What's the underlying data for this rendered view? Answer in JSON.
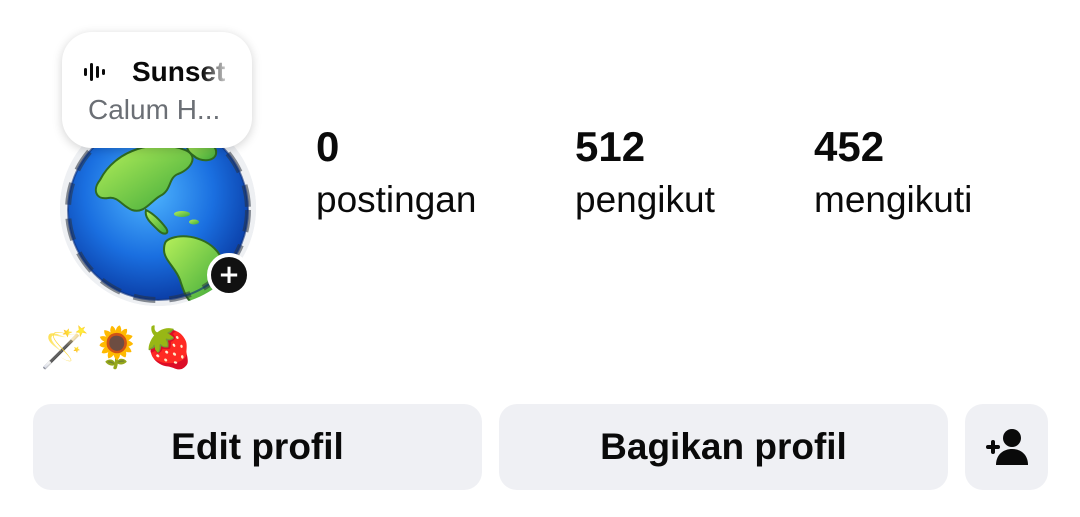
{
  "note": {
    "song_title": "Sunset",
    "artist": "Calum H...",
    "icon": "equalizer-icon"
  },
  "avatar": {
    "description_icon": "globe-avatar",
    "add_icon": "plus-icon"
  },
  "stats": [
    {
      "value": "0",
      "label": "postingan"
    },
    {
      "value": "512",
      "label": "pengikut"
    },
    {
      "value": "452",
      "label": "mengikuti"
    }
  ],
  "bio": {
    "emoji": [
      "🪄",
      "🌻",
      "🍓"
    ]
  },
  "actions": {
    "edit_label": "Edit profil",
    "share_label": "Bagikan profil",
    "add_person_icon": "add-person-icon"
  },
  "colors": {
    "button_bg": "#eff0f4",
    "text": "#0a0a0a",
    "muted_text": "#6b6f75"
  }
}
